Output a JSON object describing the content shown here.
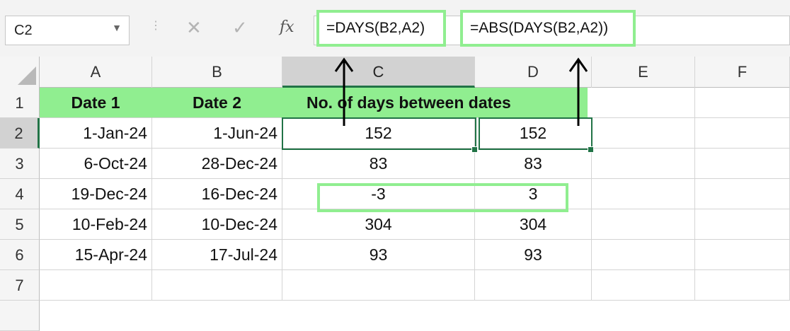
{
  "namebox": {
    "value": "C2"
  },
  "formula_icons": {
    "cancel": "✕",
    "enter": "✓",
    "fx": "fx"
  },
  "callouts": {
    "days_formula": "=DAYS(B2,A2)",
    "abs_formula": "=ABS(DAYS(B2,A2))"
  },
  "columns": [
    "A",
    "B",
    "C",
    "D",
    "E",
    "F"
  ],
  "rows": [
    "1",
    "2",
    "3",
    "4",
    "5",
    "6",
    "7"
  ],
  "header": {
    "a": "Date 1",
    "b": "Date 2",
    "cd": "No. of days between dates"
  },
  "data": [
    {
      "a": "1-Jan-24",
      "b": "1-Jun-24",
      "c": "152",
      "d": "152"
    },
    {
      "a": "6-Oct-24",
      "b": "28-Dec-24",
      "c": "83",
      "d": "83"
    },
    {
      "a": "19-Dec-24",
      "b": "16-Dec-24",
      "c": "-3",
      "d": "3"
    },
    {
      "a": "10-Feb-24",
      "b": "10-Dec-24",
      "c": "304",
      "d": "304"
    },
    {
      "a": "15-Apr-24",
      "b": "17-Jul-24",
      "c": "93",
      "d": "93"
    }
  ],
  "colors": {
    "highlight": "#90ee90",
    "selection": "#217346"
  }
}
